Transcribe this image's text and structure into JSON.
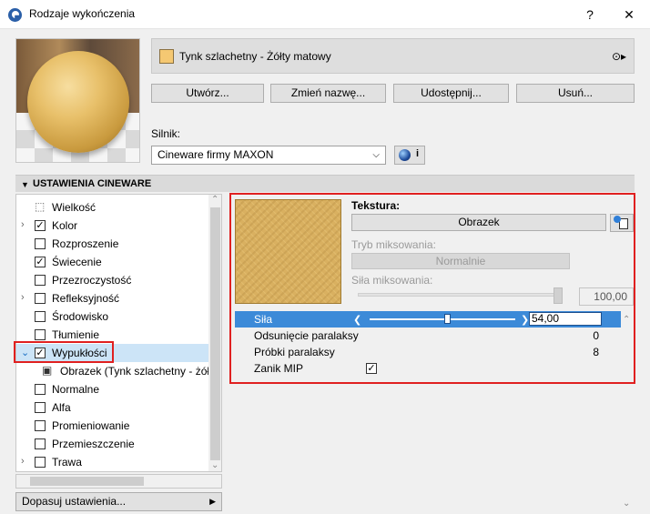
{
  "window": {
    "title": "Rodzaje wykończenia",
    "help_label": "?",
    "close_label": "✕"
  },
  "surface": {
    "name": "Tynk szlachetny - Żółty matowy",
    "swatch_color": "#f5c872",
    "menu_icon": "⊙▸"
  },
  "actions": {
    "create": "Utwórz...",
    "rename": "Zmień nazwę...",
    "share": "Udostępnij...",
    "delete": "Usuń..."
  },
  "engine": {
    "label": "Silnik:",
    "value": "Cineware firmy MAXON",
    "info_label": "i"
  },
  "section": {
    "title": "USTAWIENIA CINEWARE"
  },
  "tree": {
    "items": [
      {
        "label": "Wielkość",
        "icon": "size-icon",
        "expandable": false,
        "checkbox": null
      },
      {
        "label": "Kolor",
        "expandable": true,
        "checked": true
      },
      {
        "label": "Rozproszenie",
        "expandable": false,
        "checked": false
      },
      {
        "label": "Świecenie",
        "expandable": false,
        "checked": true
      },
      {
        "label": "Przezroczystość",
        "expandable": false,
        "checked": false
      },
      {
        "label": "Refleksyjność",
        "expandable": true,
        "checked": false
      },
      {
        "label": "Środowisko",
        "expandable": false,
        "checked": false
      },
      {
        "label": "Tłumienie",
        "expandable": false,
        "checked": false
      },
      {
        "label": "Wypukłości",
        "expandable": true,
        "expanded": true,
        "checked": true,
        "selected": true
      },
      {
        "label": "Obrazek (Tynk szlachetny - żółty",
        "child": true
      },
      {
        "label": "Normalne",
        "expandable": false,
        "checked": false
      },
      {
        "label": "Alfa",
        "expandable": false,
        "checked": false
      },
      {
        "label": "Promieniowanie",
        "expandable": false,
        "checked": false
      },
      {
        "label": "Przemieszczenie",
        "expandable": false,
        "checked": false
      },
      {
        "label": "Trawa",
        "expandable": true,
        "checked": false
      }
    ],
    "fit_button": "Dopasuj ustawienia..."
  },
  "texture": {
    "label": "Tekstura:",
    "button": "Obrazek",
    "blend_mode_label": "Tryb miksowania:",
    "blend_mode_value": "Normalnie",
    "blend_strength_label": "Siła miksowania:",
    "blend_strength_value": "100,00",
    "blend_strength_level": 1.0
  },
  "params": {
    "strength_label": "Siła",
    "strength_value": "54,00",
    "strength_level": 0.54,
    "parallax_offset_label": "Odsunięcie paralaksy",
    "parallax_offset_value": "0",
    "parallax_samples_label": "Próbki paralaksy",
    "parallax_samples_value": "8",
    "mip_label": "Zanik MIP",
    "mip_checked": true
  }
}
